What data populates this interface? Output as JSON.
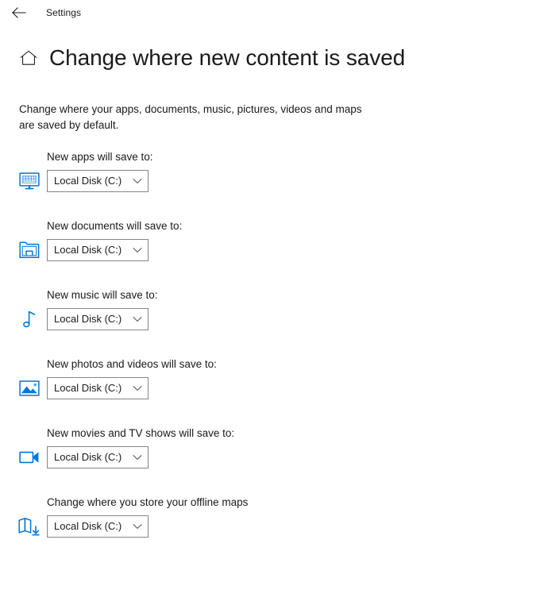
{
  "titlebar": {
    "back_label": "back-arrow",
    "app_title": "Settings"
  },
  "header": {
    "home_icon": "home-icon",
    "title": "Change where new content is saved"
  },
  "description": "Change where your apps, documents, music, pictures, videos and maps are saved by default.",
  "colors": {
    "accent": "#0078d7",
    "text": "#1a1a1a",
    "combo_border": "#868686",
    "background": "#ffffff"
  },
  "rows": [
    {
      "icon": "monitor-apps-icon",
      "label": "New apps will save to:",
      "value": "Local Disk (C:)"
    },
    {
      "icon": "documents-folder-icon",
      "label": "New documents will save to:",
      "value": "Local Disk (C:)"
    },
    {
      "icon": "music-note-icon",
      "label": "New music will save to:",
      "value": "Local Disk (C:)"
    },
    {
      "icon": "photo-picture-icon",
      "label": "New photos and videos will save to:",
      "value": "Local Disk (C:)"
    },
    {
      "icon": "video-camera-icon",
      "label": "New movies and TV shows will save to:",
      "value": "Local Disk (C:)"
    },
    {
      "icon": "offline-maps-icon",
      "label": "Change where you store your offline maps",
      "value": "Local Disk (C:)"
    }
  ]
}
